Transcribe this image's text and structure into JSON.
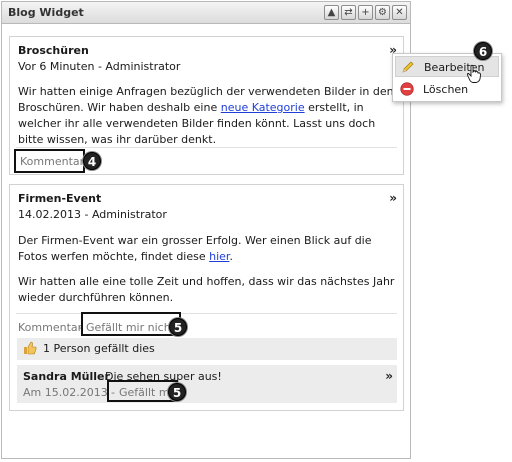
{
  "widget": {
    "title": "Blog Widget",
    "tools": [
      {
        "icon": "collapse-icon",
        "glyph": "▲"
      },
      {
        "icon": "refresh-icon",
        "glyph": "⇄"
      },
      {
        "icon": "add-icon",
        "glyph": "+"
      },
      {
        "icon": "settings-icon",
        "glyph": "⚙"
      },
      {
        "icon": "close-icon",
        "glyph": "✕"
      }
    ]
  },
  "post1": {
    "title": "Broschüren",
    "meta": "Vor 6 Minuten - Administrator",
    "text_before": "Wir hatten einige Anfragen bezüglich der verwendeten Bilder in den Broschüren. Wir haben deshalb eine ",
    "link": "neue Kategorie",
    "text_after": " erstellt, in welcher ihr alle verwendeten Bilder finden könnt. Lasst uns doch bitte wissen, was ihr darüber denkt.",
    "comment_label": "Kommentar",
    "badge": "4"
  },
  "menu": {
    "edit_label": "Bearbeiten",
    "delete_label": "Löschen",
    "badge": "6"
  },
  "post2": {
    "title": "Firmen-Event",
    "meta": "14.02.2013 - Administrator",
    "text_before": "Der Firmen-Event war ein grosser Erfolg. Wer einen Blick auf die Fotos werfen möchte, findet diese ",
    "link": "hier",
    "text_after": ".",
    "paragraph2": "Wir hatten alle eine tolle Zeit und hoffen, dass wir das nächstes Jahr wieder durchführen können.",
    "comment_label": "Kommentar",
    "separator": "-",
    "unlike_label": "Gefällt mir nicht",
    "badge": "5",
    "likes_text": "1 Person gefällt dies"
  },
  "reply": {
    "author": "Sandra Müller",
    "text": "Die sehen super aus!",
    "date": "Am 15.02.2013",
    "separator": "-",
    "like_label": "Gefällt mir",
    "badge": "5"
  },
  "colors": {
    "link": "#1f3fd8",
    "muted": "#777777",
    "badge": "#222222",
    "delete": "#e04040"
  }
}
